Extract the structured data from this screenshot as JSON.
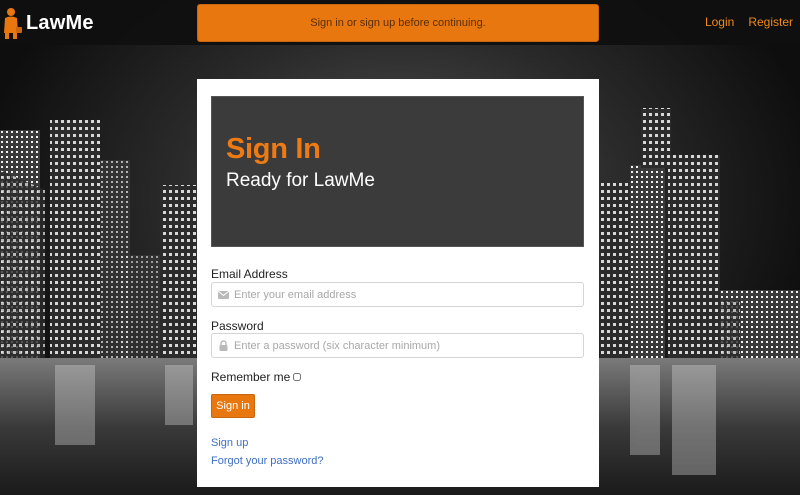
{
  "brand": {
    "name": "LawMe"
  },
  "flash": {
    "message": "Sign in or sign up before continuing."
  },
  "nav": {
    "login": "Login",
    "register": "Register"
  },
  "hero": {
    "title": "Sign In",
    "subtitle": "Ready for LawMe"
  },
  "form": {
    "email_label": "Email Address",
    "email_placeholder": "Enter your email address",
    "password_label": "Password",
    "password_placeholder": "Enter a password (six character minimum)",
    "remember_label": "Remember me",
    "submit_label": "Sign in"
  },
  "links": {
    "sign_up": "Sign up",
    "forgot_password": "Forgot your password?"
  },
  "colors": {
    "accent": "#e8770f",
    "link": "#3d6ec2",
    "hero_bg": "#3b3b3b"
  }
}
